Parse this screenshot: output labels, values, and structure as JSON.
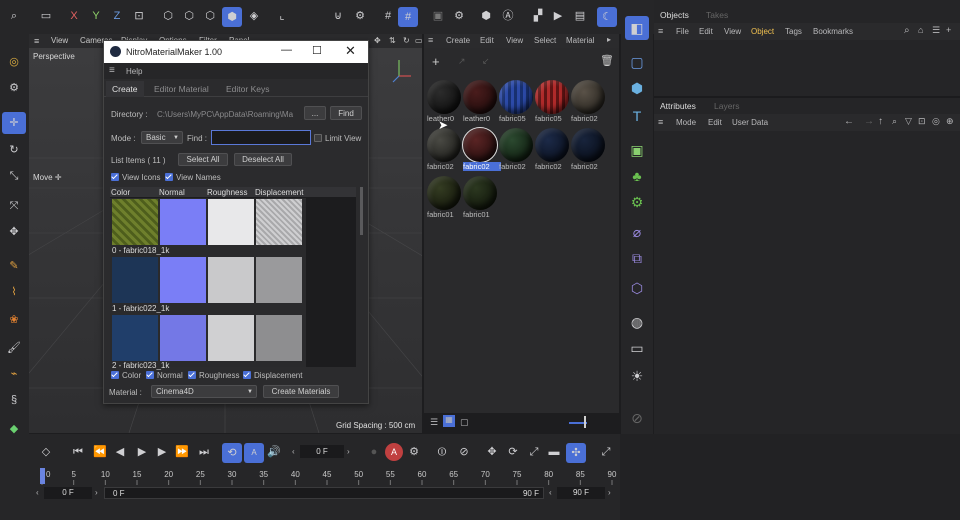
{
  "top_toolbar": {
    "icons": [
      "undo-icon",
      "redo-icon",
      "x-axis-icon",
      "y-axis-icon",
      "z-axis-icon",
      "coordinate-icon",
      "model-mode-icon",
      "point-mode-icon",
      "edge-mode-icon",
      "polygon-mode-icon",
      "uv-mode-icon",
      "workplane-icon",
      "snap-icon",
      "snap-settings-icon",
      "grid-icon",
      "render-region-icon"
    ],
    "axes": [
      "X",
      "Y",
      "Z"
    ]
  },
  "viewport": {
    "menu": [
      "View",
      "Cameras",
      "Display",
      "Options",
      "Filter",
      "Panel"
    ],
    "label": "Perspective",
    "move_label": "Move",
    "grid_spacing": "Grid Spacing : 500 cm"
  },
  "dialog": {
    "title": "NitroMaterialMaker 1.00",
    "menu_help": "Help",
    "tabs": [
      "Create",
      "Editor Material",
      "Editor Keys"
    ],
    "directory_label": "Directory :",
    "directory_value": "C:\\Users\\MyPC\\AppData\\Roaming\\Ma",
    "browse_label": "...",
    "find_button": "Find",
    "mode_label": "Mode :",
    "mode_value": "Basic",
    "find_label": "Find :",
    "find_value": "",
    "limit_view": "Limit View",
    "list_items": "List Items ( 11 )",
    "select_all": "Select All",
    "deselect_all": "Deselect All",
    "view_icons": "View Icons",
    "view_names": "View Names",
    "columns": [
      "Color",
      "Normal",
      "Roughness",
      "Displacement"
    ],
    "rows": [
      {
        "name": "0 - fabric018_1k",
        "color": "#6e7f2c"
      },
      {
        "name": "1 - fabric022_1k",
        "color": "#1d3556"
      },
      {
        "name": "2 - fabric023_1k",
        "color": "#203e6a"
      }
    ],
    "bottom_checks": [
      "Color",
      "Normal",
      "Roughness",
      "Displacement"
    ],
    "material_label": "Material :",
    "material_value": "Cinema4D",
    "create_materials": "Create Materials"
  },
  "material_manager": {
    "menu": [
      "Create",
      "Edit",
      "View",
      "Select",
      "Material"
    ],
    "materials": [
      {
        "label": "leather0",
        "color": "#151515"
      },
      {
        "label": "leather0",
        "color": "#2a1212"
      },
      {
        "label": "fabric05",
        "color": "#2c4aa8"
      },
      {
        "label": "fabric05",
        "color": "#9a2020"
      },
      {
        "label": "fabric02",
        "color": "#3a342c"
      },
      {
        "label": "fabric02",
        "color": "#2a2a26"
      },
      {
        "label": "fabric02",
        "color": "#3a1818"
      },
      {
        "label": "fabric02",
        "color": "#18301c"
      },
      {
        "label": "fabric02",
        "color": "#101a2c"
      },
      {
        "label": "fabric02",
        "color": "#0e1626"
      },
      {
        "label": "fabric01",
        "color": "#1e2414"
      },
      {
        "label": "fabric01",
        "color": "#1a2212"
      }
    ]
  },
  "objects_panel": {
    "tabs": [
      "Objects",
      "Takes"
    ],
    "menu": [
      "File",
      "Edit",
      "View",
      "Object",
      "Tags",
      "Bookmarks"
    ],
    "active_menu": "Object"
  },
  "attributes_panel": {
    "tabs": [
      "Attributes",
      "Layers"
    ],
    "menu": [
      "Mode",
      "Edit",
      "User Data"
    ]
  },
  "timeline": {
    "current_frame": "0 F",
    "ticks": [
      "0",
      "5",
      "10",
      "15",
      "20",
      "25",
      "30",
      "35",
      "40",
      "45",
      "50",
      "55",
      "60",
      "65",
      "70",
      "75",
      "80",
      "85",
      "90"
    ],
    "start_left": "0 F",
    "start_right": "0 F",
    "end_left": "90 F",
    "end_right": "90 F"
  },
  "colors": {
    "accent": "#4a6fd6",
    "bg": "#1d1d1f",
    "panel": "#2b2b2d"
  }
}
